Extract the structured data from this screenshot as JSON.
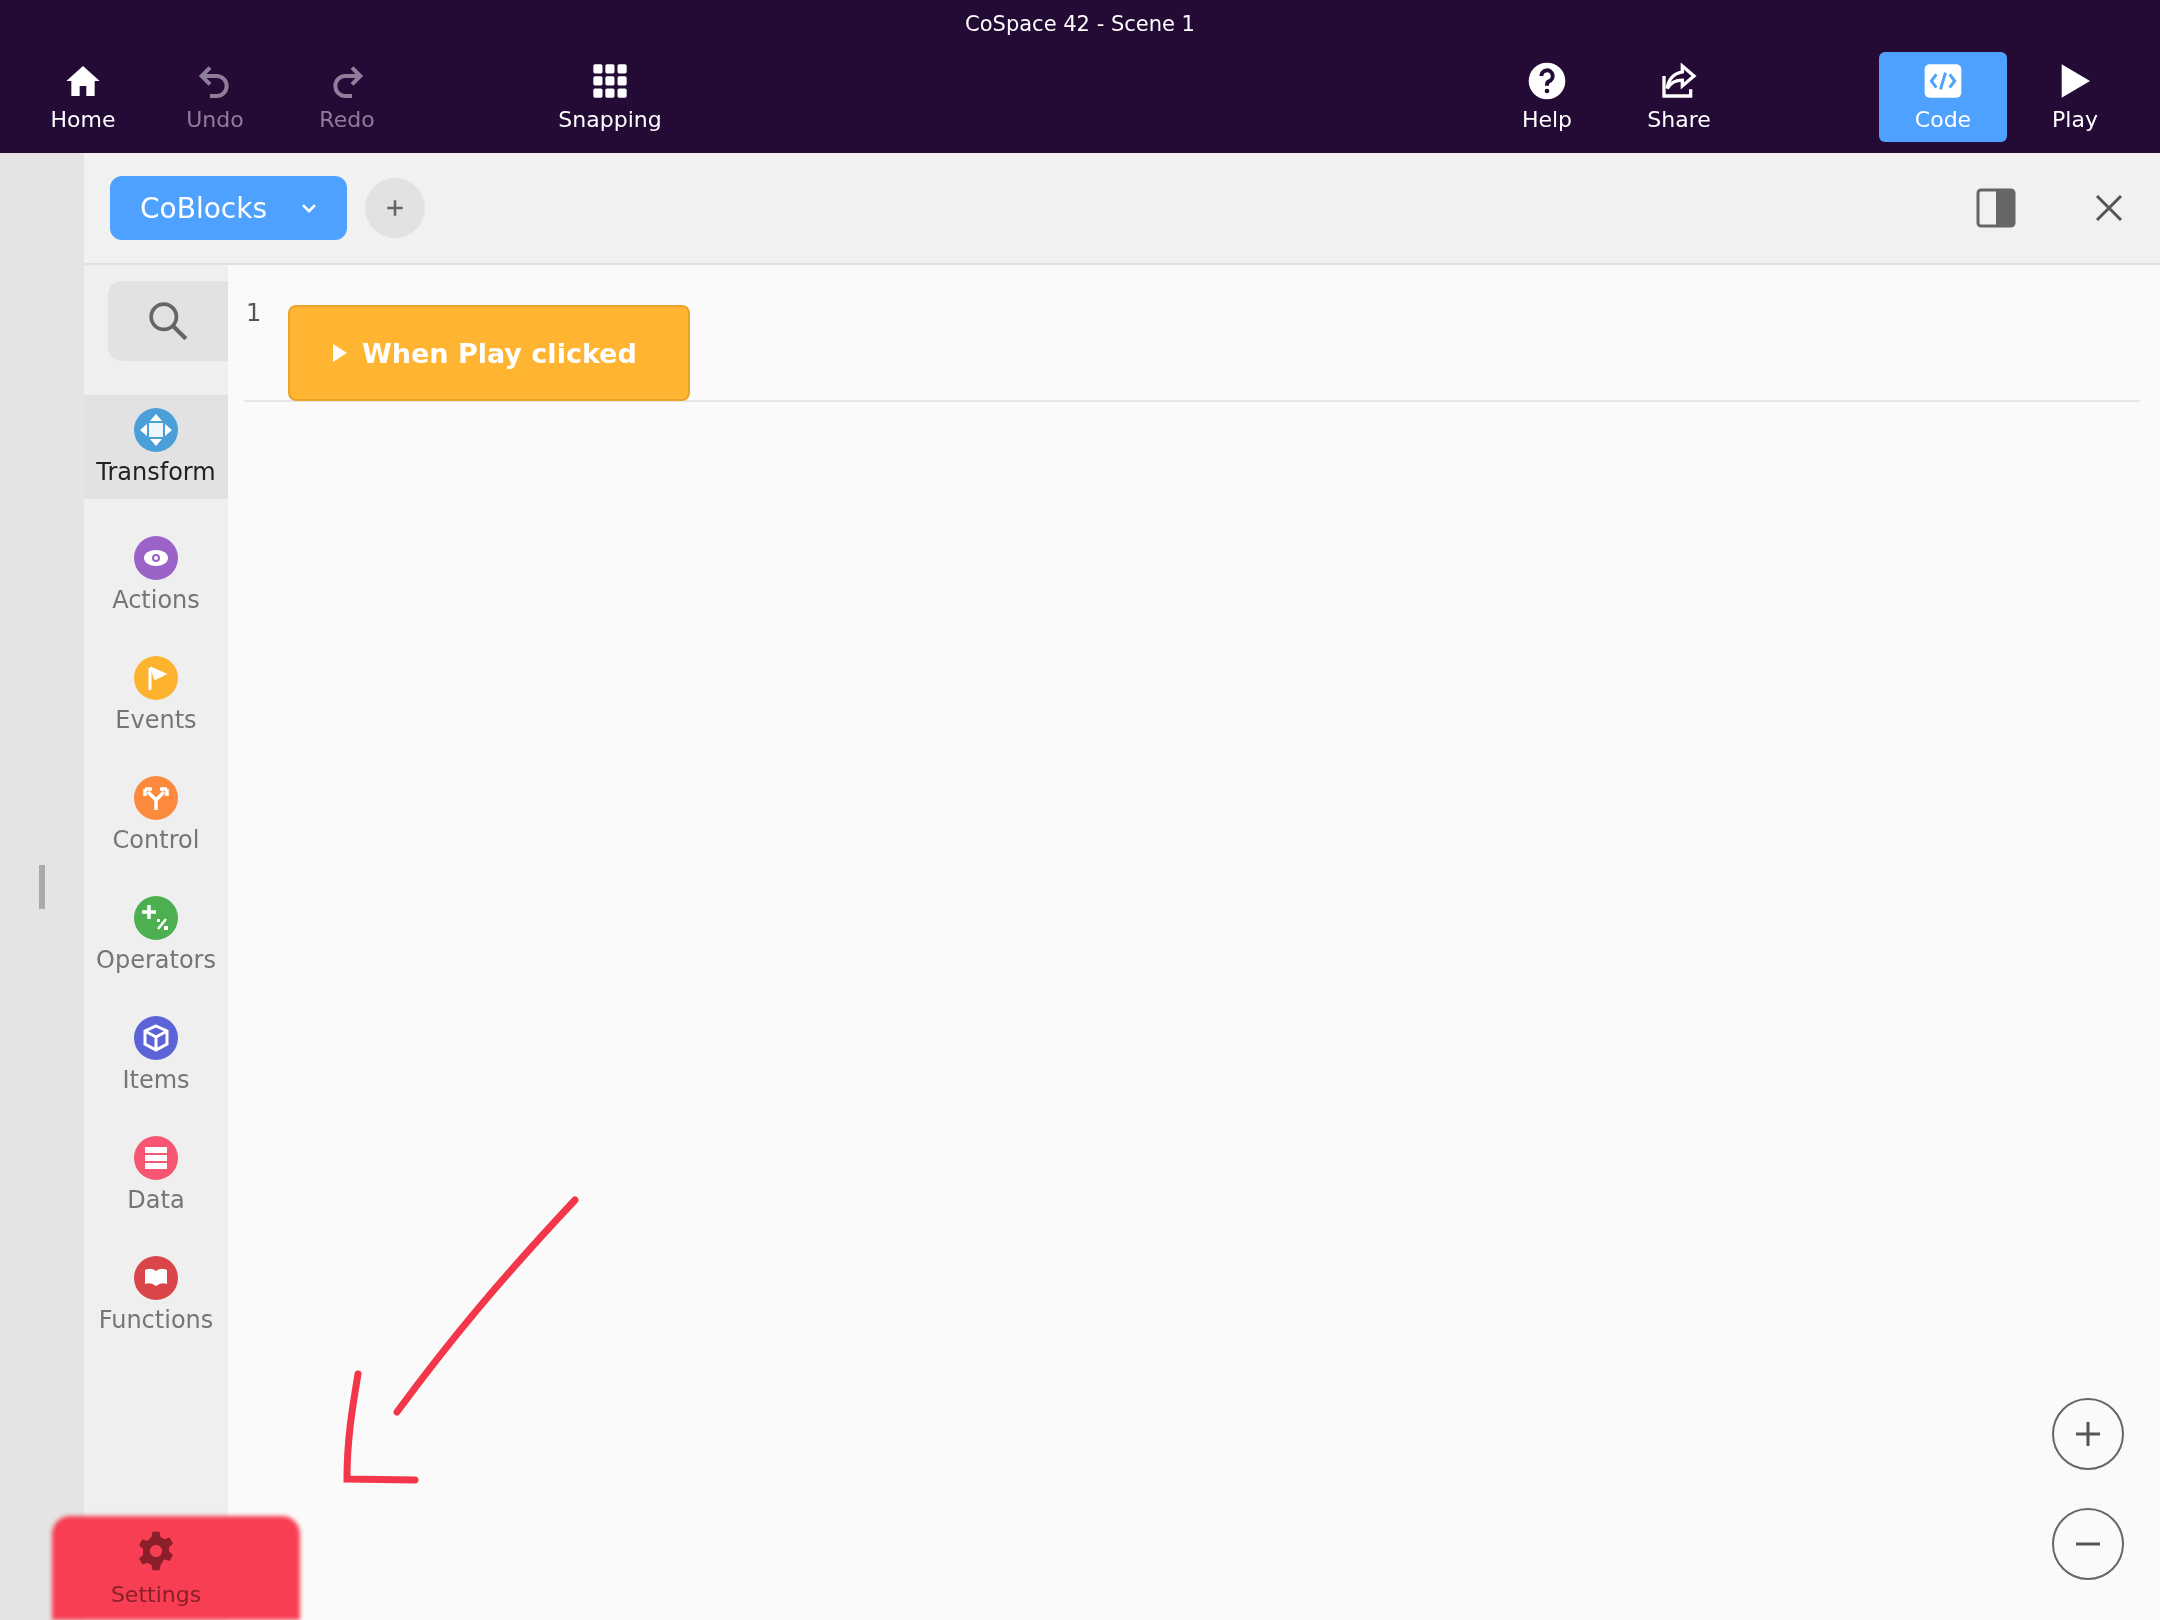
{
  "window": {
    "title": "CoSpace 42 - Scene 1"
  },
  "toolbar_left": [
    {
      "kind": "home",
      "label": "Home",
      "disabled": false
    },
    {
      "kind": "undo",
      "label": "Undo",
      "disabled": true
    },
    {
      "kind": "redo",
      "label": "Redo",
      "disabled": true
    }
  ],
  "toolbar_center": [
    {
      "kind": "grid",
      "label": "Snapping",
      "disabled": false
    }
  ],
  "toolbar_right": [
    {
      "kind": "help",
      "label": "Help",
      "selected": false
    },
    {
      "kind": "share",
      "label": "Share",
      "selected": false
    },
    {
      "kind": "code",
      "label": "Code",
      "selected": true
    },
    {
      "kind": "play",
      "label": "Play",
      "selected": false
    }
  ],
  "editor": {
    "language_button": "CoBlocks",
    "line_number": "1",
    "block": "When Play clicked"
  },
  "palette": [
    {
      "kind": "transform",
      "label": "Transform",
      "color": "#4a9fd8",
      "selected": true
    },
    {
      "kind": "actions",
      "label": "Actions",
      "color": "#9b63c8",
      "selected": false
    },
    {
      "kind": "events",
      "label": "Events",
      "color": "#fdb32e",
      "selected": false
    },
    {
      "kind": "control",
      "label": "Control",
      "color": "#fb8a3c",
      "selected": false
    },
    {
      "kind": "operators",
      "label": "Operators",
      "color": "#4caf50",
      "selected": false
    },
    {
      "kind": "items",
      "label": "Items",
      "color": "#5c63d6",
      "selected": false
    },
    {
      "kind": "data",
      "label": "Data",
      "color": "#f65672",
      "selected": false
    },
    {
      "kind": "functions",
      "label": "Functions",
      "color": "#d94548",
      "selected": false
    }
  ],
  "settings": {
    "label": "Settings"
  }
}
